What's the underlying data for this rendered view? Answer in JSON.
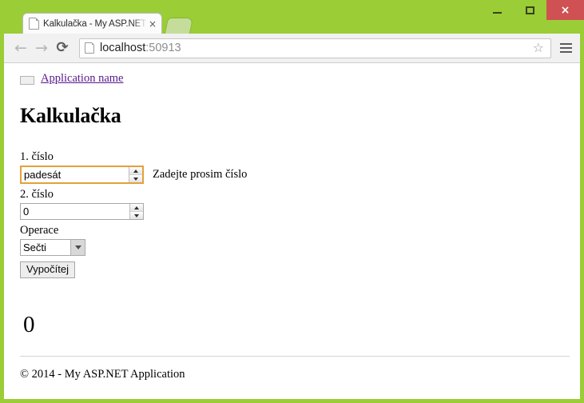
{
  "browser": {
    "tab": {
      "title": "Kalkulačka - My ASP.NET ",
      "close_label": "×",
      "favicon": "page-icon"
    },
    "new_tab_label": "+",
    "window_controls": {
      "minimize": "minimize-icon",
      "maximize": "maximize-icon",
      "close": "×",
      "close_color": "#cf5153"
    },
    "toolbar": {
      "back": "←",
      "forward": "→",
      "reload": "⟳",
      "url_host": "localhost",
      "url_port": ":50913",
      "bookmark": "☆",
      "menu": "menu-icon"
    },
    "chrome_accent_color": "#9acd36"
  },
  "page": {
    "brand_link": "Application name",
    "title": "Kalkulačka",
    "form": {
      "label_first": "1. číslo",
      "first_value": "padesát",
      "first_invalid": true,
      "invalid_border_color": "#e3a13a",
      "validation_message": "Zadejte prosim číslo",
      "label_second": "2. číslo",
      "second_value": "0",
      "label_operation": "Operace",
      "operation_selected": "Sečti",
      "operation_options": [
        "Sečti"
      ],
      "submit_label": "Vypočítej"
    },
    "result": "0",
    "footer": "© 2014 - My ASP.NET Application"
  }
}
